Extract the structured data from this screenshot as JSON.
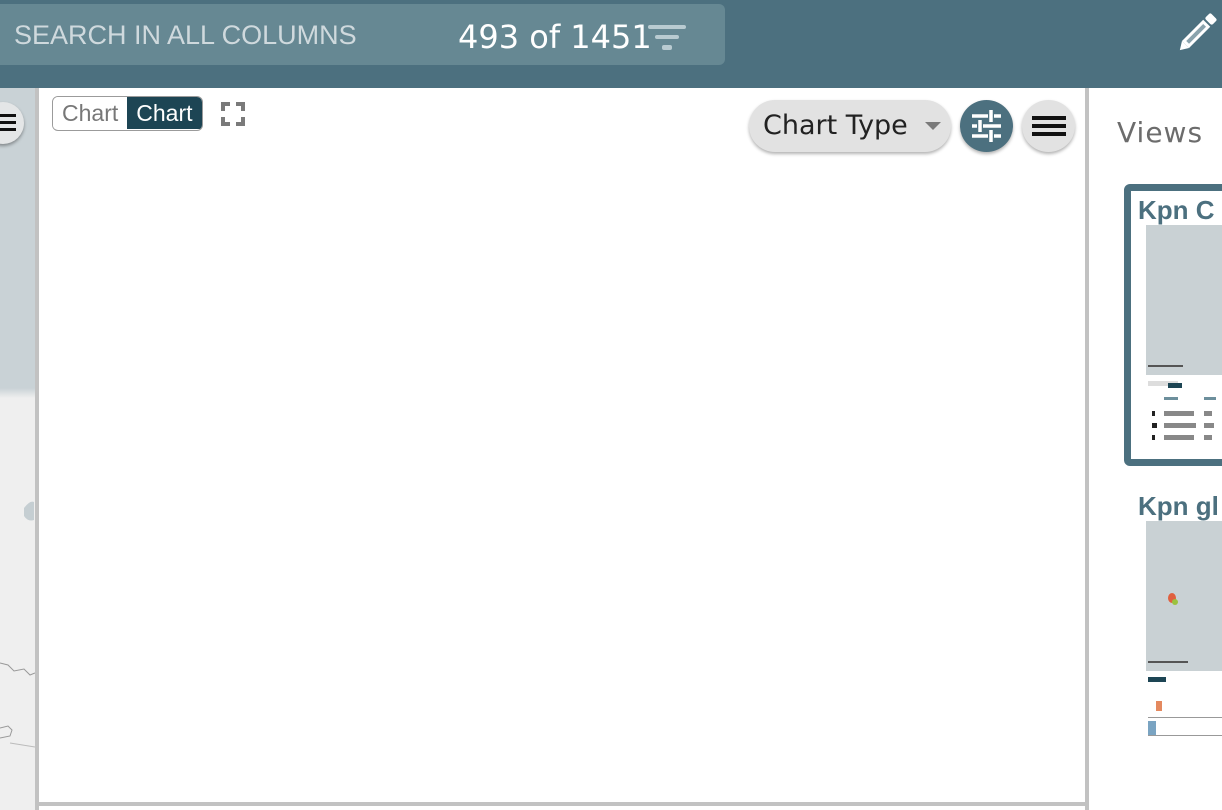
{
  "header": {
    "search_placeholder": "SEARCH IN ALL COLUMNS",
    "search_value": "",
    "record_count": "493 of 1451",
    "filter_icon": "filter-icon",
    "edit_icon": "pencil-icon"
  },
  "left_panel": {
    "menu_icon": "hamburger-icon"
  },
  "chart_panel": {
    "toggle": [
      {
        "label": "Chart",
        "active": false
      },
      {
        "label": "Chart",
        "active": true
      }
    ],
    "expand_icon": "fullscreen-icon",
    "chart_type_label": "Chart Type",
    "settings_icon": "sliders-icon",
    "menu_icon": "hamburger-icon"
  },
  "views": {
    "title": "Views",
    "items": [
      {
        "name": "Kpn C",
        "selected": true
      },
      {
        "name": "Kpn gl",
        "selected": false
      }
    ]
  },
  "colors": {
    "header_bg": "#4c707f",
    "search_bg": "#668893",
    "toggle_active": "#1d4554",
    "accent": "#4c707f",
    "divider": "#c2c2c2"
  }
}
